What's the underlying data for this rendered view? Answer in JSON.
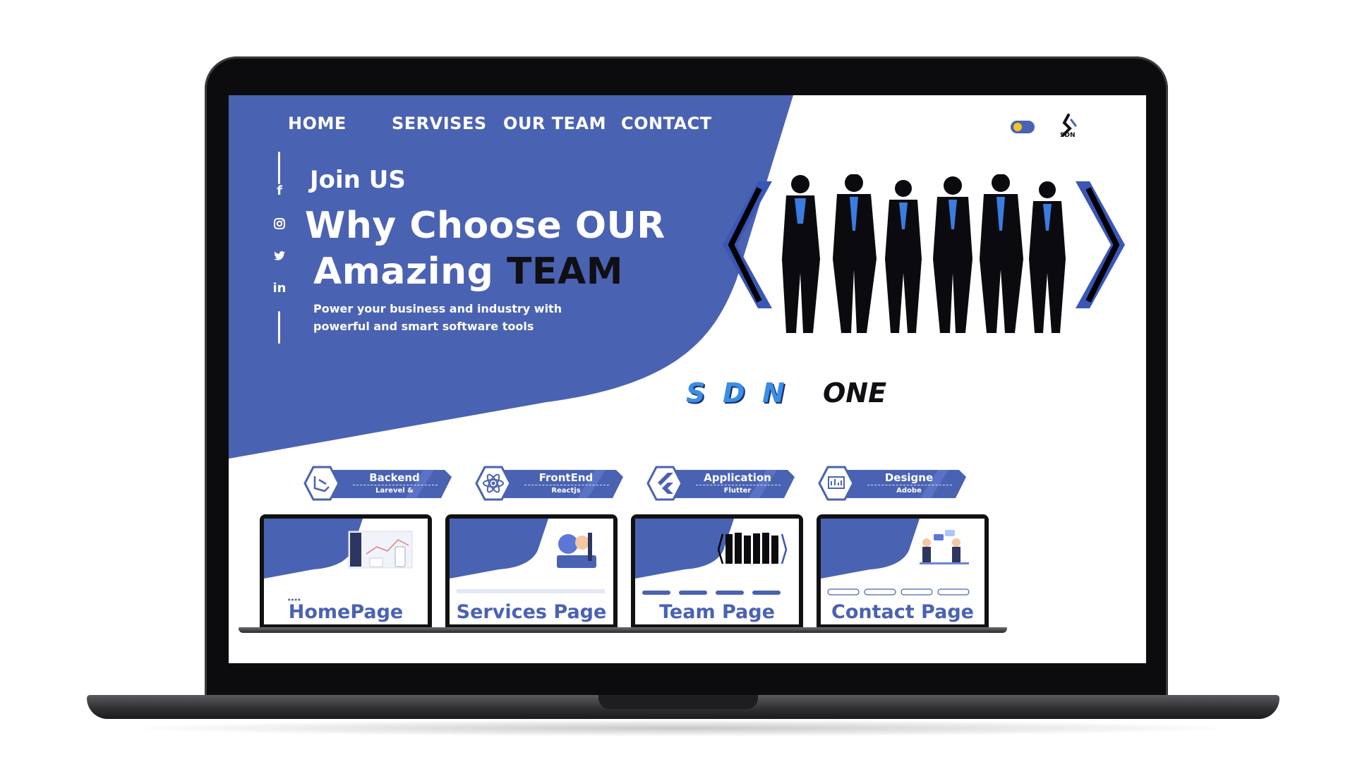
{
  "nav": {
    "items": [
      "HOME",
      "SERVISES",
      "OUR TEAM",
      "CONTACT"
    ]
  },
  "logo": {
    "text": "SDN"
  },
  "hero": {
    "eyebrow": "Join US",
    "headline_line1": "Why Choose OUR",
    "headline_line2_a": "Amazing ",
    "headline_line2_b": "TEAM",
    "subtitle": "Power your business and industry with powerful and smart software tools"
  },
  "brand": {
    "letters": [
      "S",
      "D",
      "N"
    ],
    "word": "ONE"
  },
  "social": {
    "icons": [
      "facebook-icon",
      "instagram-icon",
      "twitter-icon",
      "linkedin-icon"
    ]
  },
  "tech_badges": [
    {
      "title": "Backend",
      "subtitle": "Larevel &",
      "icon": "laravel-icon"
    },
    {
      "title": "FrontEnd",
      "subtitle": "Reactjs",
      "icon": "react-icon"
    },
    {
      "title": "Application",
      "subtitle": "Flutter",
      "icon": "flutter-icon"
    },
    {
      "title": "Designe",
      "subtitle": "Adobe",
      "icon": "design-icon"
    }
  ],
  "page_previews": [
    {
      "label": "HomePage"
    },
    {
      "label": "Services Page"
    },
    {
      "label": "Team Page"
    },
    {
      "label": "Contact Page"
    }
  ],
  "colors": {
    "primary": "#4a62b2",
    "primary_light": "#5b78d8",
    "dark": "#0f0f14",
    "accent_blue": "#3a8ee6",
    "toggle_knob": "#f3c623"
  }
}
